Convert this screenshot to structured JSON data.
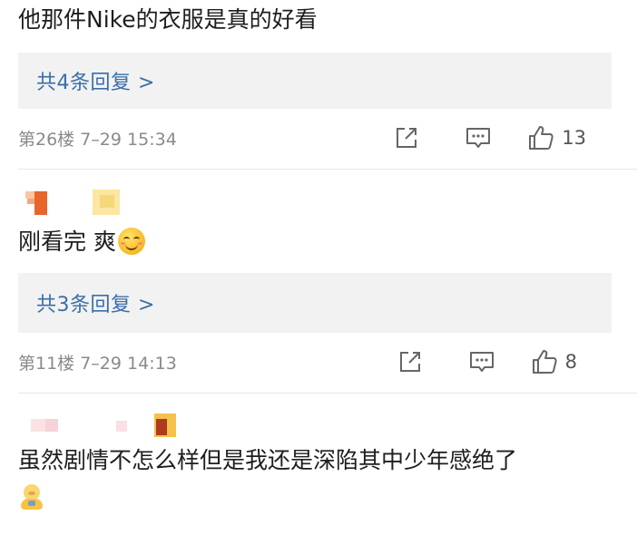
{
  "comments": [
    {
      "text": "他那件Nike的衣服是真的好看",
      "reply_label": "共4条回复 >",
      "meta": "第26楼 7–29 15:34",
      "likes": "13"
    },
    {
      "text": "刚看完 爽",
      "emoji": "smiling-face-emoji",
      "reply_label": "共3条回复 >",
      "meta": "第11楼 7–29 14:13",
      "likes": "8"
    },
    {
      "text": "虽然剧情不怎么样但是我还是深陷其中少年感绝了",
      "emoji": "baby-emoji"
    }
  ],
  "icons": {
    "share": "share-icon",
    "reply": "comment-icon",
    "like": "thumbs-up-icon"
  },
  "colors": {
    "reply_link": "#3a6fa8",
    "reply_box_bg": "#f2f2f2",
    "meta_text": "#8a8a8a",
    "icon_gray": "#666666"
  }
}
